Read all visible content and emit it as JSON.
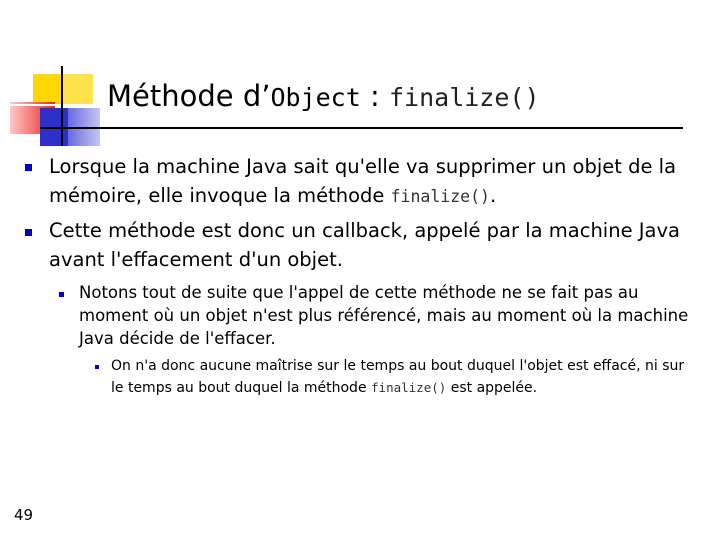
{
  "slide": {
    "title_prefix": "Méthode d’",
    "title_code_object": "Object",
    "title_sep": " : ",
    "title_code_method": "finalize()",
    "page_number": "49"
  },
  "bullets": {
    "b1_text": "Lorsque la machine Java sait qu'elle va supprimer un objet de la mémoire, elle invoque la méthode ",
    "b1_code": "finalize()",
    "b1_tail": ".",
    "b2_text": "Cette méthode est donc un callback, appelé par la machine Java avant l'effacement d'un objet.",
    "b2_1_text": "Notons tout de suite que l'appel de cette méthode ne se fait pas au moment où un objet n'est plus référencé, mais au moment où la machine Java décide de l'effacer.",
    "b2_1_1_text": "On n'a donc aucune maîtrise sur le temps au bout duquel l'objet est effacé, ni sur le temps au bout duquel la méthode ",
    "b2_1_1_code": "finalize()",
    "b2_1_1_tail": " est appelée."
  },
  "colors": {
    "yellow": "#ffd700",
    "red": "#ee2222",
    "blue": "#2e2ec8",
    "bullet": "#0000cc"
  }
}
